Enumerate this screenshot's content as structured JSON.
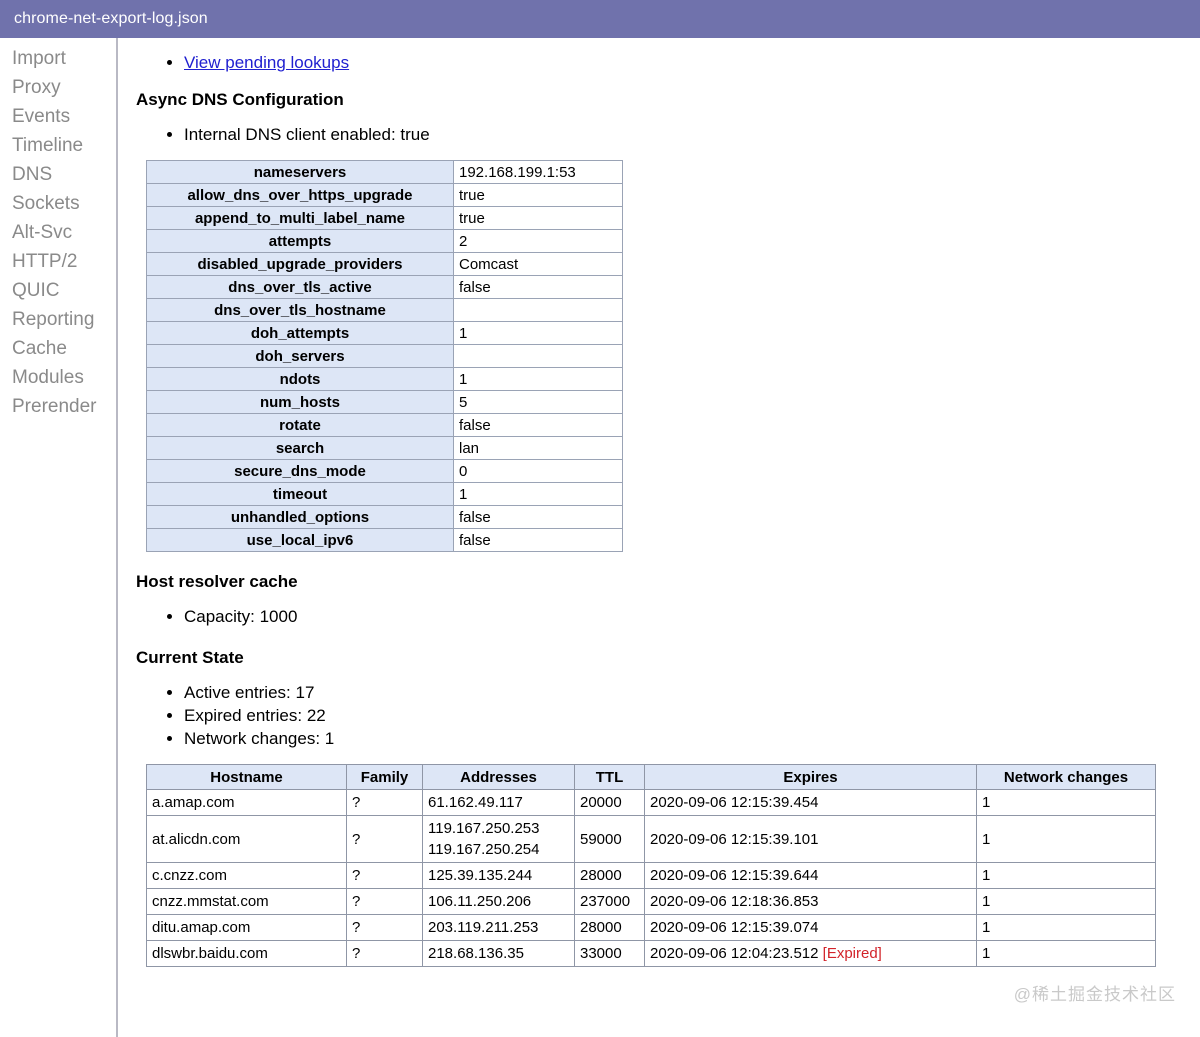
{
  "window": {
    "title": "chrome-net-export-log.json",
    "titlebar_color": "#7072ac"
  },
  "sidebar": {
    "items": [
      {
        "label": "Import"
      },
      {
        "label": "Proxy"
      },
      {
        "label": "Events"
      },
      {
        "label": "Timeline"
      },
      {
        "label": "DNS"
      },
      {
        "label": "Sockets"
      },
      {
        "label": "Alt-Svc"
      },
      {
        "label": "HTTP/2"
      },
      {
        "label": "QUIC"
      },
      {
        "label": "Reporting"
      },
      {
        "label": "Cache"
      },
      {
        "label": "Modules"
      },
      {
        "label": "Prerender"
      }
    ]
  },
  "main": {
    "top_link": "View pending lookups",
    "async_dns": {
      "heading": "Async DNS Configuration",
      "bullets": [
        "Internal DNS client enabled: true"
      ],
      "config_rows": [
        {
          "key": "nameservers",
          "value": "192.168.199.1:53"
        },
        {
          "key": "allow_dns_over_https_upgrade",
          "value": "true"
        },
        {
          "key": "append_to_multi_label_name",
          "value": "true"
        },
        {
          "key": "attempts",
          "value": "2"
        },
        {
          "key": "disabled_upgrade_providers",
          "value": "Comcast"
        },
        {
          "key": "dns_over_tls_active",
          "value": "false"
        },
        {
          "key": "dns_over_tls_hostname",
          "value": ""
        },
        {
          "key": "doh_attempts",
          "value": "1"
        },
        {
          "key": "doh_servers",
          "value": ""
        },
        {
          "key": "ndots",
          "value": "1"
        },
        {
          "key": "num_hosts",
          "value": "5"
        },
        {
          "key": "rotate",
          "value": "false"
        },
        {
          "key": "search",
          "value": "lan"
        },
        {
          "key": "secure_dns_mode",
          "value": "0"
        },
        {
          "key": "timeout",
          "value": "1"
        },
        {
          "key": "unhandled_options",
          "value": "false"
        },
        {
          "key": "use_local_ipv6",
          "value": "false"
        }
      ]
    },
    "host_resolver_cache": {
      "heading": "Host resolver cache",
      "bullets": [
        "Capacity: 1000"
      ]
    },
    "current_state": {
      "heading": "Current State",
      "bullets": [
        "Active entries: 17",
        "Expired entries: 22",
        "Network changes: 1"
      ],
      "table": {
        "columns": [
          "Hostname",
          "Family",
          "Addresses",
          "TTL",
          "Expires",
          "Network changes"
        ],
        "rows": [
          {
            "hostname": "a.amap.com",
            "family": "?",
            "addresses": "61.162.49.117",
            "ttl": "20000",
            "expires": "2020-09-06 12:15:39.454",
            "expired_tag": "",
            "network_changes": "1"
          },
          {
            "hostname": "at.alicdn.com",
            "family": "?",
            "addresses": "119.167.250.253\n119.167.250.254",
            "ttl": "59000",
            "expires": "2020-09-06 12:15:39.101",
            "expired_tag": "",
            "network_changes": "1"
          },
          {
            "hostname": "c.cnzz.com",
            "family": "?",
            "addresses": "125.39.135.244",
            "ttl": "28000",
            "expires": "2020-09-06 12:15:39.644",
            "expired_tag": "",
            "network_changes": "1"
          },
          {
            "hostname": "cnzz.mmstat.com",
            "family": "?",
            "addresses": "106.11.250.206",
            "ttl": "237000",
            "expires": "2020-09-06 12:18:36.853",
            "expired_tag": "",
            "network_changes": "1"
          },
          {
            "hostname": "ditu.amap.com",
            "family": "?",
            "addresses": "203.119.211.253",
            "ttl": "28000",
            "expires": "2020-09-06 12:15:39.074",
            "expired_tag": "",
            "network_changes": "1"
          },
          {
            "hostname": "dlswbr.baidu.com",
            "family": "?",
            "addresses": "218.68.136.35",
            "ttl": "33000",
            "expires": "2020-09-06 12:04:23.512",
            "expired_tag": "[Expired]",
            "network_changes": "1"
          }
        ]
      }
    }
  },
  "watermark": {
    "text": "@稀土掘金技术社区"
  },
  "colors": {
    "titlebar": "#7072ac",
    "table_header": "#dde6f6",
    "link": "#2020d0",
    "expired": "#d2232a",
    "sidebar_text": "#8a8a8a"
  }
}
